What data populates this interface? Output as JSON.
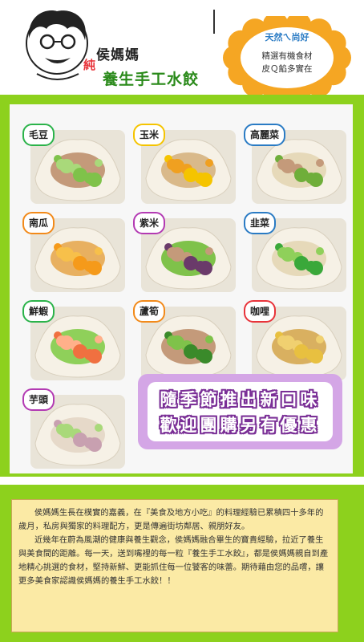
{
  "brand": {
    "name": "侯媽媽",
    "pure": "純",
    "tagline": "養生手工水餃"
  },
  "badge": {
    "tag": "天然ㄟ尚好",
    "line1": "精選有機食材",
    "line2": "皮Ｑ餡多實在",
    "color": "#f5a623"
  },
  "flavors": [
    {
      "label": "毛豆",
      "icon": "edamame-dumpling"
    },
    {
      "label": "玉米",
      "icon": "corn-dumpling"
    },
    {
      "label": "高麗菜",
      "icon": "cabbage-dumpling"
    },
    {
      "label": "南瓜",
      "icon": "pumpkin-dumpling"
    },
    {
      "label": "紫米",
      "icon": "purple-rice-dumpling"
    },
    {
      "label": "韭菜",
      "icon": "chive-dumpling"
    },
    {
      "label": "鮮蝦",
      "icon": "shrimp-dumpling"
    },
    {
      "label": "蘆筍",
      "icon": "asparagus-dumpling"
    },
    {
      "label": "咖哩",
      "icon": "curry-dumpling"
    },
    {
      "label": "芋頭",
      "icon": "taro-dumpling"
    }
  ],
  "promo": {
    "line1": "隨季節推出新口味",
    "line2": "歡迎團購另有優惠"
  },
  "story": {
    "p1": "侯媽媽生長在樸實的嘉義，在『美食及地方小吃』的料理經驗已累積四十多年的歲月，私房與獨家的料理配方，更是傳遍街坊鄰居、親朋好友。",
    "p2": "近幾年在蔚為風潮的健康與養生觀念，侯媽媽融合畢生的寶貴經驗，拉近了養生與美食間的距離。每一天，送到嘴裡的每一粒『養生手工水餃』，都是侯媽媽親自到產地精心挑選的食材，堅持新鮮、更能抓住每一位饕客的味蕾。期待藉由您的品嚐，讓更多美食家認識侯媽媽的養生手工水餃！！"
  },
  "colors": {
    "green": "#8dd11d",
    "label_border_cycle": [
      "#2bb34a",
      "#f5c400",
      "#2a7bc4",
      "#f28a1a",
      "#b33ab3",
      "#2a7bc4",
      "#2bb34a",
      "#f28a1a",
      "#e8333a",
      "#b33ab3"
    ]
  }
}
